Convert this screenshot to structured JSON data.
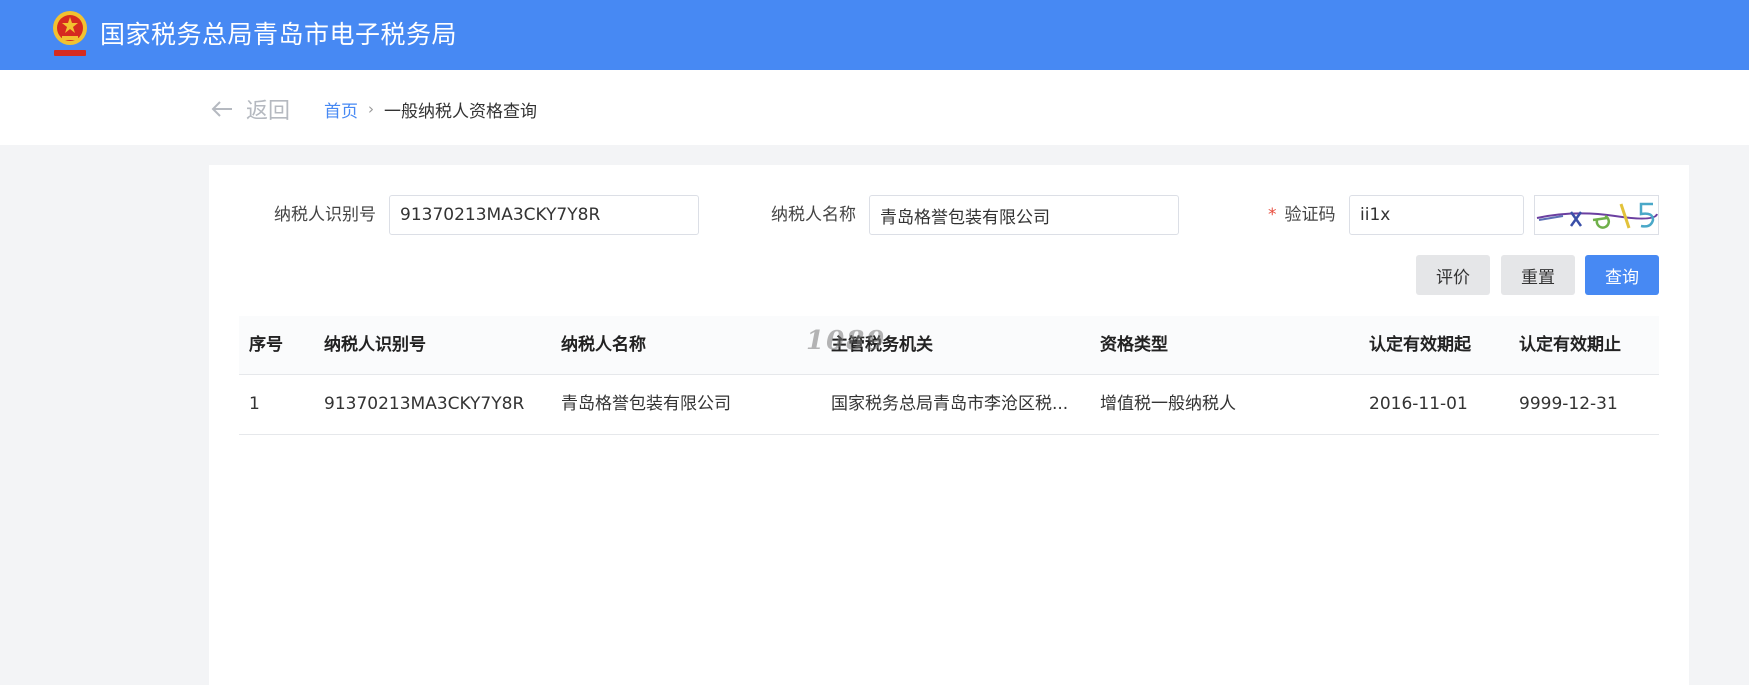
{
  "header": {
    "title": "国家税务总局青岛市电子税务局",
    "brand_color": "#4789f3"
  },
  "nav": {
    "back_label": "返回",
    "breadcrumb": {
      "home": "首页",
      "separator": "›",
      "current": "一般纳税人资格查询"
    }
  },
  "form": {
    "taxpayer_id": {
      "label": "纳税人识别号",
      "value": "91370213MA3CKY7Y8R"
    },
    "taxpayer_name": {
      "label": "纳税人名称",
      "value": "青岛格誉包装有限公司"
    },
    "captcha": {
      "required_mark": "*",
      "label": "验证码",
      "value": "ii1x"
    },
    "buttons": {
      "evaluate": "评价",
      "reset": "重置",
      "query": "查询"
    }
  },
  "table": {
    "columns": [
      "序号",
      "纳税人识别号",
      "纳税人名称",
      "主管税务机关",
      "资格类型",
      "认定有效期起",
      "认定有效期止"
    ],
    "rows": [
      [
        "1",
        "91370213MA3CKY7Y8R",
        "青岛格誉包装有限公司",
        "国家税务总局青岛市李沧区税...",
        "增值税一般纳税人",
        "2016-11-01",
        "9999-12-31"
      ]
    ]
  },
  "watermark": "1089"
}
